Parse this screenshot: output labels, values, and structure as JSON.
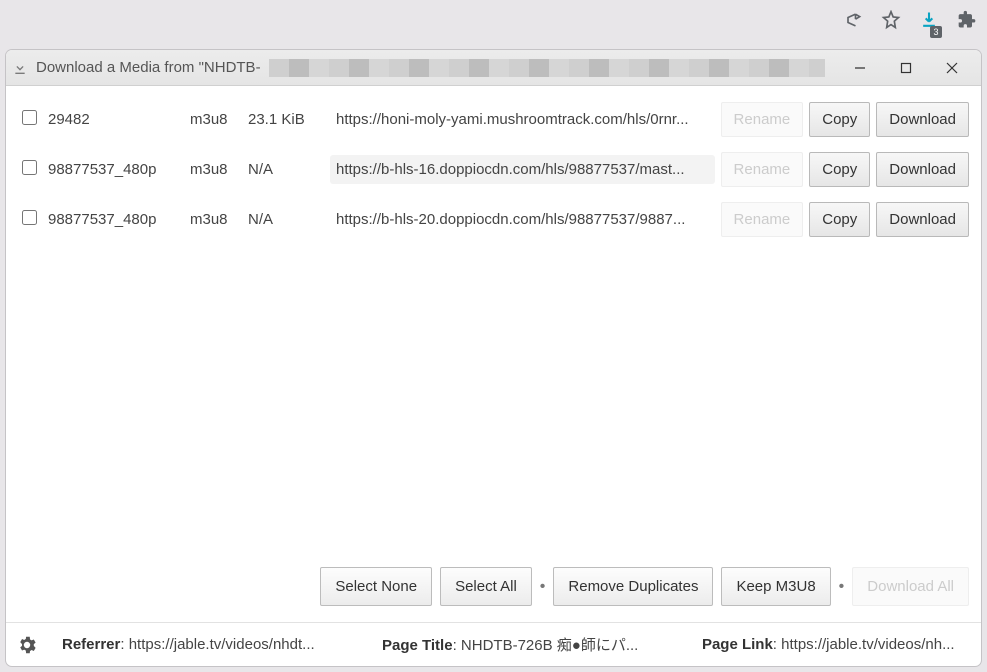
{
  "browser_ext_badge": "3",
  "window": {
    "title_prefix": "Download a Media from \"NHDTB-"
  },
  "buttons": {
    "rename": "Rename",
    "copy": "Copy",
    "download": "Download"
  },
  "rows": [
    {
      "name": "29482",
      "ext": "m3u8",
      "size": "23.1 KiB",
      "url": "https://honi-moly-yami.mushroomtrack.com/hls/0rnr...",
      "highlight": false
    },
    {
      "name": "98877537_480p",
      "ext": "m3u8",
      "size": "N/A",
      "url": "https://b-hls-16.doppiocdn.com/hls/98877537/mast...",
      "highlight": true
    },
    {
      "name": "98877537_480p",
      "ext": "m3u8",
      "size": "N/A",
      "url": "https://b-hls-20.doppiocdn.com/hls/98877537/9887...",
      "highlight": false
    }
  ],
  "footer": {
    "select_none": "Select None",
    "select_all": "Select All",
    "remove_dup": "Remove Duplicates",
    "keep_m3u8": "Keep M3U8",
    "download_all": "Download All"
  },
  "status": {
    "referrer_label": "Referrer",
    "referrer": "https://jable.tv/videos/nhdt...",
    "page_title_label": "Page Title",
    "page_title": "NHDTB-726B 痴●師にパ...",
    "page_link_label": "Page Link",
    "page_link": "https://jable.tv/videos/nh..."
  }
}
